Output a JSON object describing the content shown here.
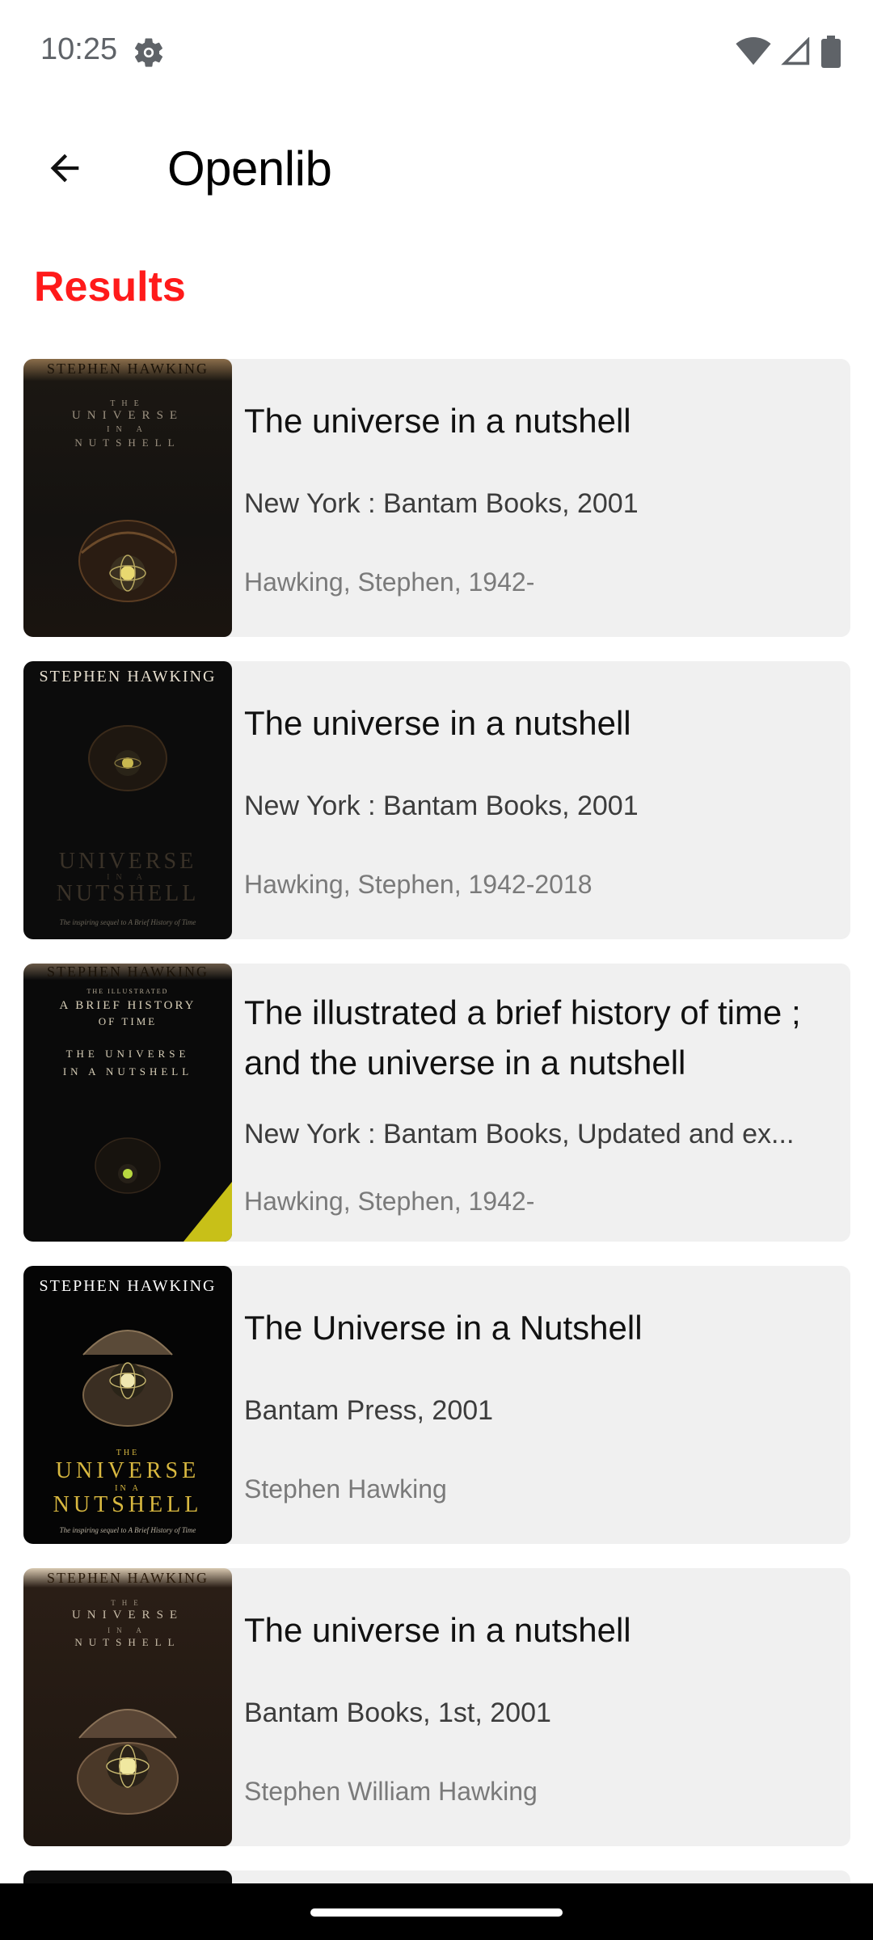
{
  "status_bar": {
    "time": "10:25",
    "icons": [
      "settings-gear-icon",
      "wifi-icon",
      "cellular-signal-icon",
      "battery-icon"
    ]
  },
  "header": {
    "back_icon": "arrow-back-icon",
    "title": "Openlib"
  },
  "results": {
    "heading": "Results",
    "heading_color": "#ff1a1a",
    "items": [
      {
        "title": "The universe in a nutshell",
        "publisher": "New York : Bantam Books, 2001",
        "author": "Hawking, Stephen, 1942-",
        "cover": {
          "author": "STEPHEN HAWKING",
          "line1": "THE",
          "line2": "UNIVERSE",
          "line3": "IN A",
          "line4": "NUTSHELL",
          "subtitle": ""
        }
      },
      {
        "title": "The universe in a nutshell",
        "publisher": "New York : Bantam Books, 2001",
        "author": "Hawking, Stephen, 1942-2018",
        "cover": {
          "author": "STEPHEN HAWKING",
          "line1": "THE",
          "line2": "UNIVERSE",
          "line3": "IN A",
          "line4": "NUTSHELL",
          "subtitle": "The inspiring sequel to A Brief History of Time"
        }
      },
      {
        "title": "The illustrated a brief history of time ; and the universe in a nutshell",
        "publisher": "New York : Bantam Books, Updated and ex...",
        "author": "Hawking, Stephen, 1942-",
        "cover": {
          "author": "STEPHEN HAWKING",
          "line1": "THE ILLUSTRATED",
          "line2": "A BRIEF HISTORY",
          "line3": "OF TIME",
          "line4": "THE UNIVERSE",
          "line5": "IN A NUTSHELL",
          "subtitle": ""
        }
      },
      {
        "title": "The Universe in a Nutshell",
        "publisher": "Bantam Press, 2001",
        "author": "Stephen Hawking",
        "cover": {
          "author": "STEPHEN HAWKING",
          "line1": "THE",
          "line2": "UNIVERSE",
          "line3": "IN A",
          "line4": "NUTSHELL",
          "subtitle": "The inspiring sequel to A Brief History of Time"
        }
      },
      {
        "title": "The universe in a nutshell",
        "publisher": "Bantam Books, 1st, 2001",
        "author": "Stephen William Hawking",
        "cover": {
          "author": "STEPHEN HAWKING",
          "line1": "THE",
          "line2": "UNIVERSE",
          "line3": "IN A",
          "line4": "NUTSHELL",
          "subtitle": ""
        }
      }
    ]
  }
}
